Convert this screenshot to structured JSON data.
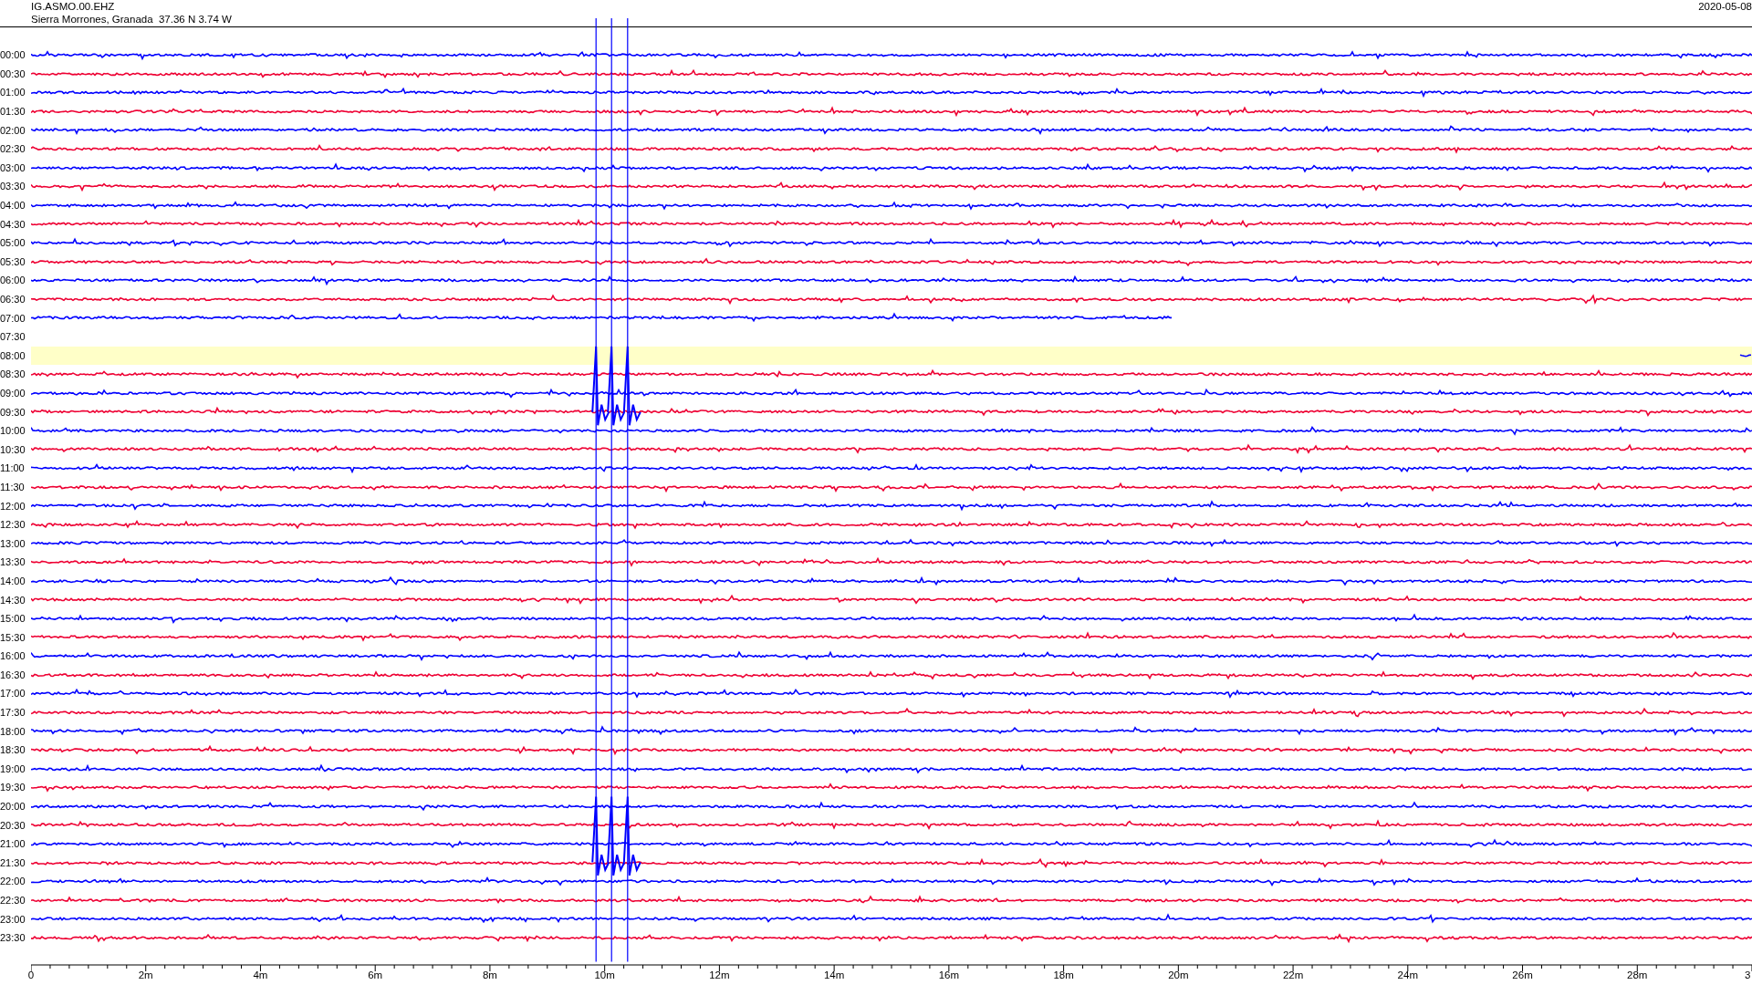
{
  "header": {
    "station": "IG.ASMO.00.EHZ",
    "location": "Sierra Morrones, Granada  37.36 N 3.74 W",
    "date": "2020-05-08"
  },
  "rows": [
    {
      "label": "00:00",
      "color": "#0000ff",
      "kind": "full",
      "highlighted": false
    },
    {
      "label": "00:30",
      "color": "#ee0033",
      "kind": "full",
      "highlighted": false
    },
    {
      "label": "01:00",
      "color": "#0000ff",
      "kind": "full",
      "highlighted": false
    },
    {
      "label": "01:30",
      "color": "#ee0033",
      "kind": "full",
      "highlighted": false
    },
    {
      "label": "02:00",
      "color": "#0000ff",
      "kind": "full",
      "highlighted": false
    },
    {
      "label": "02:30",
      "color": "#ee0033",
      "kind": "full",
      "highlighted": false
    },
    {
      "label": "03:00",
      "color": "#0000ff",
      "kind": "full",
      "highlighted": false
    },
    {
      "label": "03:30",
      "color": "#ee0033",
      "kind": "full",
      "highlighted": false
    },
    {
      "label": "04:00",
      "color": "#0000ff",
      "kind": "full",
      "highlighted": false
    },
    {
      "label": "04:30",
      "color": "#ee0033",
      "kind": "full",
      "highlighted": false
    },
    {
      "label": "05:00",
      "color": "#0000ff",
      "kind": "full",
      "highlighted": false
    },
    {
      "label": "05:30",
      "color": "#ee0033",
      "kind": "full",
      "highlighted": false
    },
    {
      "label": "06:00",
      "color": "#0000ff",
      "kind": "full",
      "highlighted": false
    },
    {
      "label": "06:30",
      "color": "#ee0033",
      "kind": "full",
      "highlighted": false
    },
    {
      "label": "07:00",
      "color": "#0000ff",
      "kind": "partial",
      "highlighted": false
    },
    {
      "label": "07:30",
      "kind": "empty",
      "highlighted": false
    },
    {
      "label": "08:00",
      "color": "#0000ff",
      "kind": "end",
      "highlighted": true
    },
    {
      "label": "08:30",
      "color": "#ee0033",
      "kind": "full",
      "highlighted": false
    },
    {
      "label": "09:00",
      "color": "#0000ff",
      "kind": "full",
      "highlighted": false
    },
    {
      "label": "09:30",
      "color": "#ee0033",
      "kind": "full",
      "highlighted": false
    },
    {
      "label": "10:00",
      "color": "#0000ff",
      "kind": "full",
      "highlighted": false
    },
    {
      "label": "10:30",
      "color": "#ee0033",
      "kind": "full",
      "highlighted": false
    },
    {
      "label": "11:00",
      "color": "#0000ff",
      "kind": "full",
      "highlighted": false
    },
    {
      "label": "11:30",
      "color": "#ee0033",
      "kind": "full",
      "highlighted": false
    },
    {
      "label": "12:00",
      "color": "#0000ff",
      "kind": "full",
      "highlighted": false
    },
    {
      "label": "12:30",
      "color": "#ee0033",
      "kind": "full",
      "highlighted": false
    },
    {
      "label": "13:00",
      "color": "#0000ff",
      "kind": "full",
      "highlighted": false
    },
    {
      "label": "13:30",
      "color": "#ee0033",
      "kind": "full",
      "highlighted": false
    },
    {
      "label": "14:00",
      "color": "#0000ff",
      "kind": "full",
      "highlighted": false
    },
    {
      "label": "14:30",
      "color": "#ee0033",
      "kind": "full",
      "highlighted": false
    },
    {
      "label": "15:00",
      "color": "#0000ff",
      "kind": "full",
      "highlighted": false
    },
    {
      "label": "15:30",
      "color": "#ee0033",
      "kind": "full",
      "highlighted": false
    },
    {
      "label": "16:00",
      "color": "#0000ff",
      "kind": "full",
      "highlighted": false
    },
    {
      "label": "16:30",
      "color": "#ee0033",
      "kind": "full",
      "highlighted": false
    },
    {
      "label": "17:00",
      "color": "#0000ff",
      "kind": "full",
      "highlighted": false
    },
    {
      "label": "17:30",
      "color": "#ee0033",
      "kind": "full",
      "highlighted": false
    },
    {
      "label": "18:00",
      "color": "#0000ff",
      "kind": "full",
      "highlighted": false
    },
    {
      "label": "18:30",
      "color": "#ee0033",
      "kind": "full",
      "highlighted": false
    },
    {
      "label": "19:00",
      "color": "#0000ff",
      "kind": "full",
      "highlighted": false
    },
    {
      "label": "19:30",
      "color": "#ee0033",
      "kind": "full",
      "highlighted": false
    },
    {
      "label": "20:00",
      "color": "#0000ff",
      "kind": "full",
      "highlighted": false
    },
    {
      "label": "20:30",
      "color": "#ee0033",
      "kind": "full",
      "highlighted": false
    },
    {
      "label": "21:00",
      "color": "#0000ff",
      "kind": "full",
      "highlighted": false
    },
    {
      "label": "21:30",
      "color": "#ee0033",
      "kind": "full",
      "highlighted": false
    },
    {
      "label": "22:00",
      "color": "#0000ff",
      "kind": "full",
      "highlighted": false
    },
    {
      "label": "22:30",
      "color": "#ee0033",
      "kind": "full",
      "highlighted": false
    },
    {
      "label": "23:00",
      "color": "#0000ff",
      "kind": "full",
      "highlighted": false
    },
    {
      "label": "23:30",
      "color": "#ee0033",
      "kind": "full",
      "highlighted": false
    }
  ],
  "x_axis": {
    "labels": [
      "0",
      "2m",
      "4m",
      "6m",
      "8m",
      "10m",
      "12m",
      "14m",
      "16m",
      "18m",
      "20m",
      "22m",
      "24m",
      "26m",
      "28m",
      "3"
    ]
  }
}
